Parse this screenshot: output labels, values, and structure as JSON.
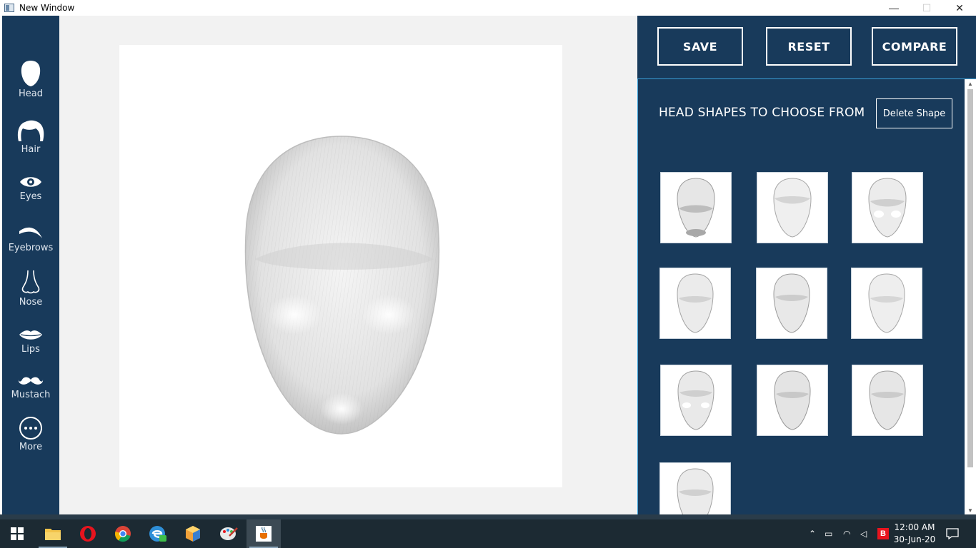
{
  "window": {
    "title": "New Window",
    "minimize_glyph": "—",
    "maximize_glyph": "☐",
    "close_glyph": "✕"
  },
  "sidebar": {
    "items": [
      {
        "label": "Head",
        "icon": "head-icon"
      },
      {
        "label": "Hair",
        "icon": "hair-icon"
      },
      {
        "label": "Eyes",
        "icon": "eye-icon"
      },
      {
        "label": "Eyebrows",
        "icon": "eyebrow-icon"
      },
      {
        "label": "Nose",
        "icon": "nose-icon"
      },
      {
        "label": "Lips",
        "icon": "lips-icon"
      },
      {
        "label": "Mustach",
        "icon": "mustache-icon"
      },
      {
        "label": "More",
        "icon": "more-icon"
      }
    ]
  },
  "toolbar": {
    "save_label": "SAVE",
    "reset_label": "RESET",
    "compare_label": "COMPARE"
  },
  "shapes_panel": {
    "title": "HEAD SHAPES TO CHOOSE FROM",
    "delete_label": "Delete Shape",
    "thumbnail_count": 10
  },
  "taskbar": {
    "apps": [
      "start-icon",
      "file-explorer-icon",
      "opera-icon",
      "chrome-icon",
      "edge-icon",
      "app-cube-icon",
      "paint-icon",
      "java-icon"
    ],
    "time": "12:00 AM",
    "date": "30-Jun-20"
  },
  "colors": {
    "panel": "#183a5b",
    "accent_border": "#3aa0d8",
    "workspace": "#f2f2f2",
    "taskbar": "#1c2a33"
  }
}
